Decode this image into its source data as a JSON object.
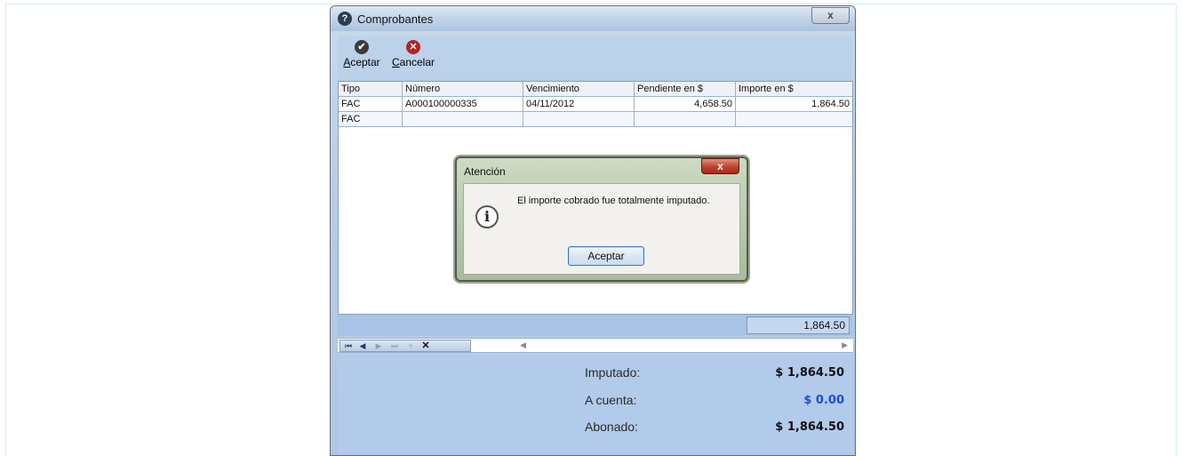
{
  "window": {
    "title": "Comprobantes",
    "close_glyph": "x"
  },
  "toolbar": {
    "accept_mnemonic": "A",
    "accept_rest": "ceptar",
    "accept_icon": "checkmark-icon",
    "cancel_mnemonic": "C",
    "cancel_rest": "ancelar",
    "cancel_icon": "cancel-icon"
  },
  "grid": {
    "headers": [
      "Tipo",
      "Número",
      "Vencimiento",
      "Pendiente en $",
      "Importe en $"
    ],
    "rows": [
      [
        "FAC",
        "A000100000335",
        "04/11/2012",
        "4,658.50",
        "1,864.50"
      ],
      [
        "FAC",
        "",
        "",
        "",
        ""
      ]
    ],
    "total": "1,864.50"
  },
  "summary": {
    "imputado_label": "Imputado:",
    "imputado_value": "$ 1,864.50",
    "cuenta_label": "A cuenta:",
    "cuenta_value": "$ 0.00",
    "abonado_label": "Abonado:",
    "abonado_value": "$ 1,864.50"
  },
  "dialog": {
    "title": "Atención",
    "message": "El importe cobrado fue totalmente imputado.",
    "ok_label": "Aceptar",
    "icon": "info-icon"
  },
  "colors": {
    "accent_blue": "#1a4fd0",
    "client_bg": "#b6cdea"
  }
}
